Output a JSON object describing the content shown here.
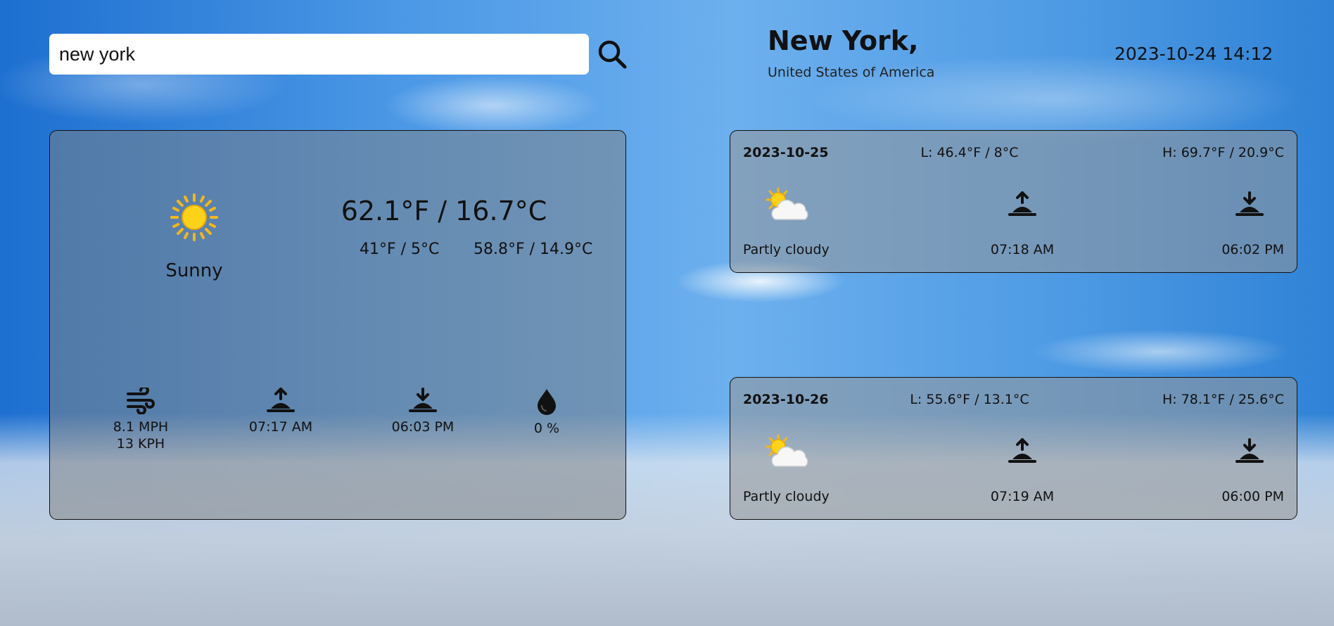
{
  "search": {
    "value": "new york",
    "button_icon": "search-icon"
  },
  "location": {
    "city": "New York,",
    "country": "United States of America"
  },
  "datetime": "2023-10-24 14:12",
  "current": {
    "condition_icon": "sun-icon",
    "condition": "Sunny",
    "temp": "62.1°F / 16.7°C",
    "low": "41°F / 5°C",
    "high": "58.8°F / 14.9°C",
    "wind_icon": "wind-icon",
    "wind_mph": "8.1 MPH",
    "wind_kph": "13 KPH",
    "sunrise_icon": "sunrise-icon",
    "sunrise": "07:17 AM",
    "sunset_icon": "sunset-icon",
    "sunset": "06:03 PM",
    "precip_icon": "raindrop-icon",
    "precip": "0 %"
  },
  "forecast": [
    {
      "date": "2023-10-25",
      "low": "L: 46.4°F / 8°C",
      "high": "H: 69.7°F / 20.9°C",
      "condition_icon": "partly-cloudy-icon",
      "condition": "Partly cloudy",
      "sunrise": "07:18 AM",
      "sunset": "06:02 PM"
    },
    {
      "date": "2023-10-26",
      "low": "L: 55.6°F / 13.1°C",
      "high": "H: 78.1°F / 25.6°C",
      "condition_icon": "partly-cloudy-icon",
      "condition": "Partly cloudy",
      "sunrise": "07:19 AM",
      "sunset": "06:00 PM"
    }
  ],
  "colors": {
    "text": "#111111",
    "sun": "#ffc21a",
    "card_border": "#111111"
  }
}
